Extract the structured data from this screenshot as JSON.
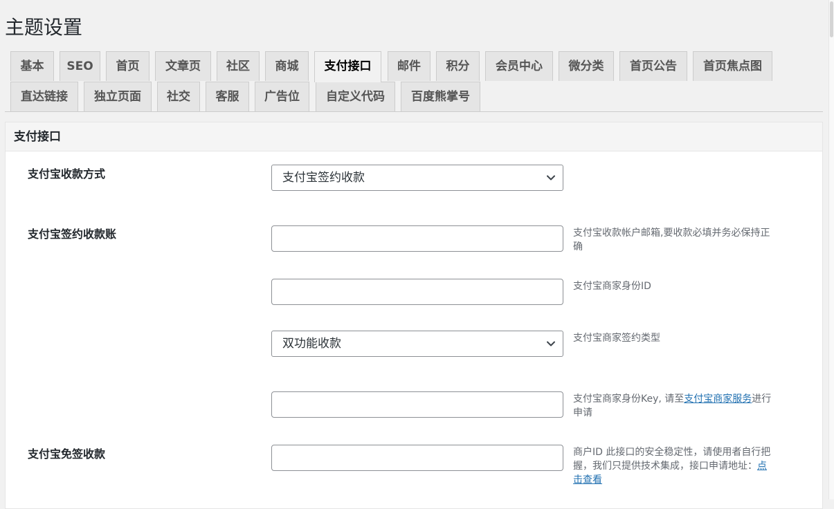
{
  "page": {
    "title": "主题设置"
  },
  "tabs": [
    {
      "label": "基本"
    },
    {
      "label": "SEO"
    },
    {
      "label": "首页"
    },
    {
      "label": "文章页"
    },
    {
      "label": "社区"
    },
    {
      "label": "商城"
    },
    {
      "label": "支付接口"
    },
    {
      "label": "邮件"
    },
    {
      "label": "积分"
    },
    {
      "label": "会员中心"
    },
    {
      "label": "微分类"
    },
    {
      "label": "首页公告"
    },
    {
      "label": "首页焦点图"
    },
    {
      "label": "直达链接"
    },
    {
      "label": "独立页面"
    },
    {
      "label": "社交"
    },
    {
      "label": "客服"
    },
    {
      "label": "广告位"
    },
    {
      "label": "自定义代码"
    },
    {
      "label": "百度熊掌号"
    }
  ],
  "active_tab": "支付接口",
  "panel": {
    "title": "支付接口",
    "collection_method": {
      "label": "支付宝收款方式",
      "selected": "支付宝签约收款"
    },
    "signed_account": {
      "label": "支付宝签约收款账",
      "email": {
        "value": "",
        "desc": "支付宝收款帐户邮箱,要收款必填并务必保持正确"
      },
      "partner_id": {
        "value": "",
        "desc": "支付宝商家身份ID"
      },
      "sign_type": {
        "selected": "双功能收款",
        "desc": "支付宝商家签约类型"
      },
      "partner_key": {
        "value": "",
        "desc_before": "支付宝商家身份Key, 请至",
        "desc_link": "支付宝商家服务",
        "desc_after": "进行申请"
      }
    },
    "free_sign": {
      "label": "支付宝免签收款",
      "merchant_id": {
        "value": "",
        "desc_before": "商户ID 此接口的安全稳定性，请使用者自行把握，我们只提供技术集成，接口申请地址：",
        "desc_link": "点击查看"
      }
    }
  },
  "colors": {
    "background": "#f1f1f1",
    "panel": "#ffffff",
    "link": "#2271b1",
    "tab_bg": "#e5e5e5"
  }
}
